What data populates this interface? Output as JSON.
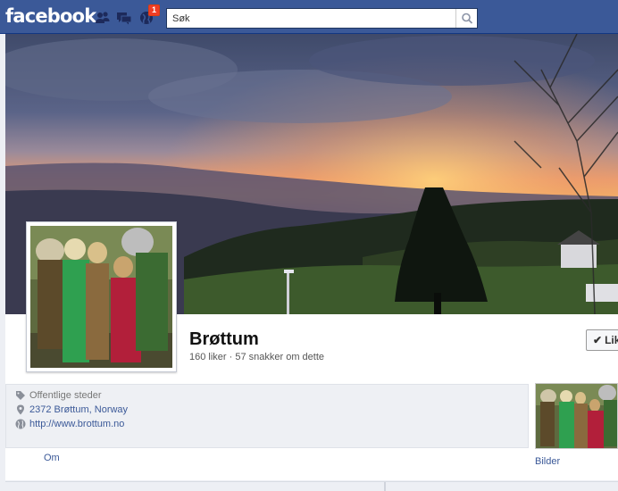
{
  "topbar": {
    "logo": "facebook",
    "notifications_count": "1",
    "search_placeholder": "Søk",
    "icons": [
      "friend-requests-icon",
      "messages-icon",
      "notifications-globe-icon",
      "search-magnifier-icon"
    ]
  },
  "colors": {
    "brand": "#3b5998",
    "badge": "#f03d25",
    "link": "#3b5998"
  },
  "page": {
    "name": "Brøttum",
    "stats": "160 liker · 57 snakker om dette",
    "like_button": "Lik"
  },
  "about": {
    "category": "Offentlige steder",
    "address": "2372 Brøttum, Norway",
    "website": "http://www.brottum.no"
  },
  "tabs": {
    "about_label": "Om",
    "photos_label": "Bilder"
  }
}
